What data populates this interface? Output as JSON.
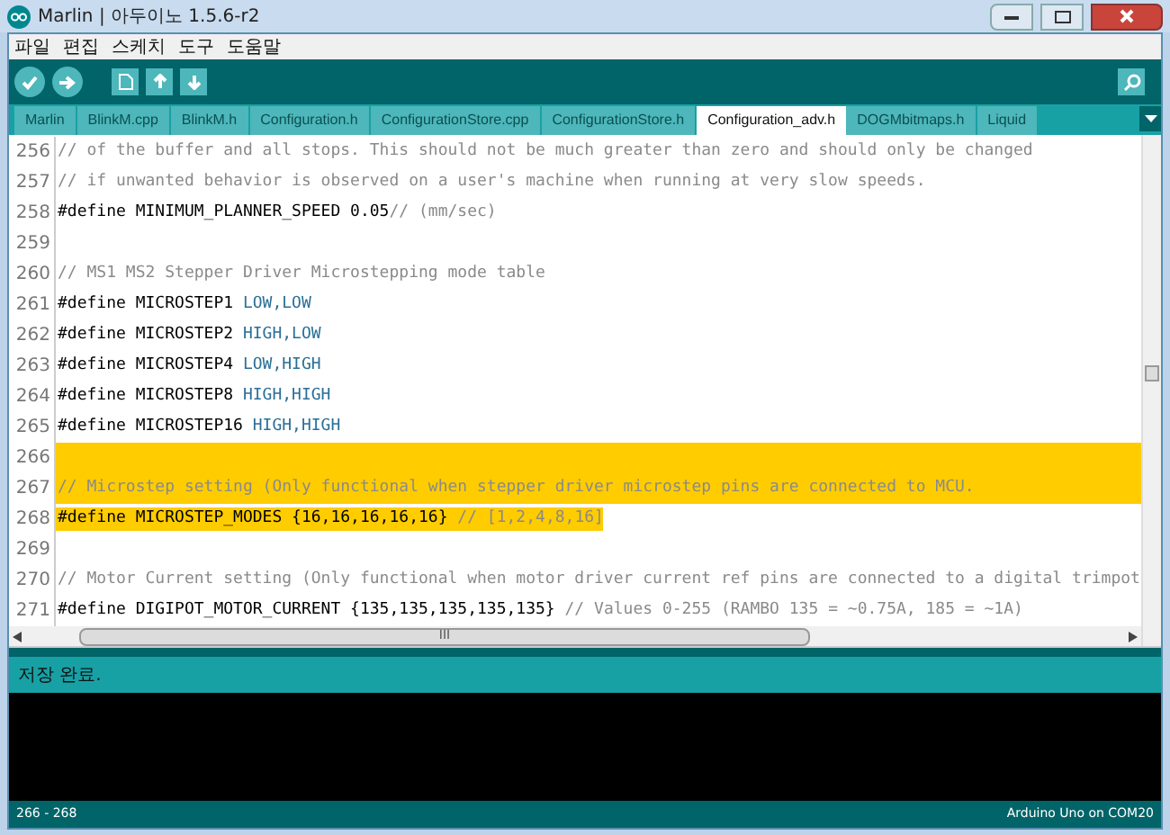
{
  "window": {
    "title": "Marlin | 아두이노 1.5.6-r2"
  },
  "menu": [
    "파일",
    "편집",
    "스케치",
    "도구",
    "도움말"
  ],
  "tabs": [
    {
      "label": "Marlin",
      "selected": false
    },
    {
      "label": "BlinkM.cpp",
      "selected": false
    },
    {
      "label": "BlinkM.h",
      "selected": false
    },
    {
      "label": "Configuration.h",
      "selected": false
    },
    {
      "label": "ConfigurationStore.cpp",
      "selected": false
    },
    {
      "label": "ConfigurationStore.h",
      "selected": false
    },
    {
      "label": "Configuration_adv.h",
      "selected": true
    },
    {
      "label": "DOGMbitmaps.h",
      "selected": false
    },
    {
      "label": "Liquid",
      "selected": false
    }
  ],
  "editor": {
    "lines": [
      {
        "number": "256",
        "selected": false,
        "segments": [
          {
            "kind": "comment",
            "text": "// of the buffer and all stops. This should not be much greater than zero and should only be changed"
          }
        ]
      },
      {
        "number": "257",
        "selected": false,
        "segments": [
          {
            "kind": "comment",
            "text": "// if unwanted behavior is observed on a user's machine when running at very slow speeds."
          }
        ]
      },
      {
        "number": "258",
        "selected": false,
        "segments": [
          {
            "kind": "plain",
            "text": "#define MINIMUM_PLANNER_SPEED 0.05"
          },
          {
            "kind": "comment",
            "text": "// (mm/sec)"
          }
        ]
      },
      {
        "number": "259",
        "selected": false
      },
      {
        "number": "260",
        "selected": false,
        "segments": [
          {
            "kind": "comment",
            "text": "// MS1 MS2 Stepper Driver Microstepping mode table"
          }
        ]
      },
      {
        "number": "261",
        "selected": false,
        "segments": [
          {
            "kind": "plain",
            "text": "#define MICROSTEP1 "
          },
          {
            "kind": "constant",
            "text": "LOW,LOW"
          }
        ]
      },
      {
        "number": "262",
        "selected": false,
        "segments": [
          {
            "kind": "plain",
            "text": "#define MICROSTEP2 "
          },
          {
            "kind": "constant",
            "text": "HIGH,LOW"
          }
        ]
      },
      {
        "number": "263",
        "selected": false,
        "segments": [
          {
            "kind": "plain",
            "text": "#define MICROSTEP4 "
          },
          {
            "kind": "constant",
            "text": "LOW,HIGH"
          }
        ]
      },
      {
        "number": "264",
        "selected": false,
        "segments": [
          {
            "kind": "plain",
            "text": "#define MICROSTEP8 "
          },
          {
            "kind": "constant",
            "text": "HIGH,HIGH"
          }
        ]
      },
      {
        "number": "265",
        "selected": false,
        "segments": [
          {
            "kind": "plain",
            "text": "#define MICROSTEP16 "
          },
          {
            "kind": "constant",
            "text": "HIGH,HIGH"
          }
        ]
      },
      {
        "number": "266",
        "selected": true
      },
      {
        "number": "267",
        "selected": true,
        "segments": [
          {
            "kind": "comment",
            "text": "// Microstep setting (Only functional when stepper driver microstep pins are connected to MCU."
          }
        ]
      },
      {
        "number": "268",
        "selected": true,
        "segments": [
          {
            "kind": "plain",
            "text": "#define MICROSTEP_MODES {16,16,16,16,16} "
          },
          {
            "kind": "comment",
            "text": "// [1,2,4,8,16]"
          }
        ]
      },
      {
        "number": "269",
        "selected": false
      },
      {
        "number": "270",
        "selected": false,
        "segments": [
          {
            "kind": "comment",
            "text": "// Motor Current setting (Only functional when motor driver current ref pins are connected to a digital trimpot"
          }
        ]
      },
      {
        "number": "271",
        "selected": false,
        "segments": [
          {
            "kind": "plain",
            "text": "#define DIGIPOT_MOTOR_CURRENT {135,135,135,135,135} "
          },
          {
            "kind": "comment",
            "text": "// Values 0-255 (RAMBO 135 = ~0.75A, 185 = ~1A)"
          }
        ]
      }
    ]
  },
  "scrollbar_grip": "III",
  "message": "저장 완료.",
  "footer": {
    "lines": "266 - 268",
    "board": "Arduino Uno on COM20"
  }
}
